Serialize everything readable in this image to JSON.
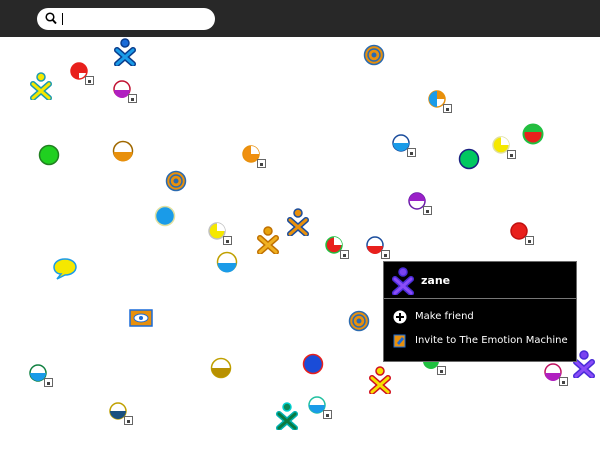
{
  "search": {
    "value": "",
    "placeholder": "",
    "icon": "magnifier-icon"
  },
  "palette": {
    "buddy_name": "zane",
    "buddy_icon": "xo-buddy-icon",
    "colors": {
      "stroke": "#4a2cd8",
      "fill": "#7a43f0"
    },
    "items": [
      {
        "label": "Make friend",
        "icon": "add-friend-icon"
      },
      {
        "label": "Invite to The Emotion Machine",
        "icon": "invite-activity-icon"
      }
    ]
  },
  "colors": {
    "topbar": "#282828",
    "accent_orange": "#e8900c",
    "accent_blue": "#1a6bd8"
  }
}
